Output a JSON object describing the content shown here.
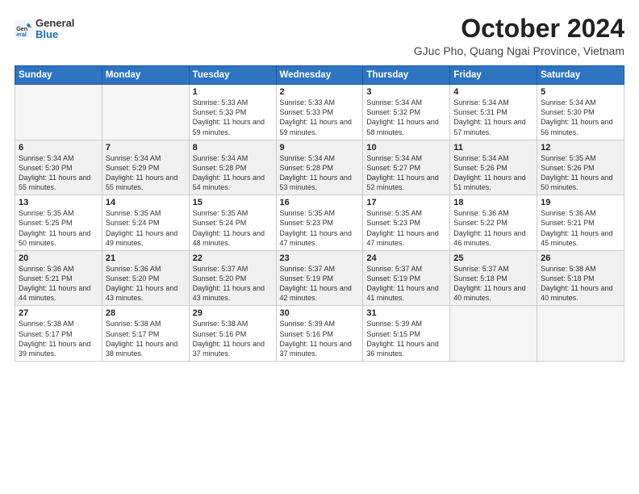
{
  "header": {
    "logo_general": "General",
    "logo_blue": "Blue",
    "month": "October 2024",
    "location": "GJuc Pho, Quang Ngai Province, Vietnam"
  },
  "weekdays": [
    "Sunday",
    "Monday",
    "Tuesday",
    "Wednesday",
    "Thursday",
    "Friday",
    "Saturday"
  ],
  "weeks": [
    [
      {
        "day": "",
        "sunrise": "",
        "sunset": "",
        "daylight": ""
      },
      {
        "day": "",
        "sunrise": "",
        "sunset": "",
        "daylight": ""
      },
      {
        "day": "1",
        "sunrise": "Sunrise: 5:33 AM",
        "sunset": "Sunset: 5:33 PM",
        "daylight": "Daylight: 11 hours and 59 minutes."
      },
      {
        "day": "2",
        "sunrise": "Sunrise: 5:33 AM",
        "sunset": "Sunset: 5:33 PM",
        "daylight": "Daylight: 11 hours and 59 minutes."
      },
      {
        "day": "3",
        "sunrise": "Sunrise: 5:34 AM",
        "sunset": "Sunset: 5:32 PM",
        "daylight": "Daylight: 11 hours and 58 minutes."
      },
      {
        "day": "4",
        "sunrise": "Sunrise: 5:34 AM",
        "sunset": "Sunset: 5:31 PM",
        "daylight": "Daylight: 11 hours and 57 minutes."
      },
      {
        "day": "5",
        "sunrise": "Sunrise: 5:34 AM",
        "sunset": "Sunset: 5:30 PM",
        "daylight": "Daylight: 11 hours and 56 minutes."
      }
    ],
    [
      {
        "day": "6",
        "sunrise": "Sunrise: 5:34 AM",
        "sunset": "Sunset: 5:30 PM",
        "daylight": "Daylight: 11 hours and 55 minutes."
      },
      {
        "day": "7",
        "sunrise": "Sunrise: 5:34 AM",
        "sunset": "Sunset: 5:29 PM",
        "daylight": "Daylight: 11 hours and 55 minutes."
      },
      {
        "day": "8",
        "sunrise": "Sunrise: 5:34 AM",
        "sunset": "Sunset: 5:28 PM",
        "daylight": "Daylight: 11 hours and 54 minutes."
      },
      {
        "day": "9",
        "sunrise": "Sunrise: 5:34 AM",
        "sunset": "Sunset: 5:28 PM",
        "daylight": "Daylight: 11 hours and 53 minutes."
      },
      {
        "day": "10",
        "sunrise": "Sunrise: 5:34 AM",
        "sunset": "Sunset: 5:27 PM",
        "daylight": "Daylight: 11 hours and 52 minutes."
      },
      {
        "day": "11",
        "sunrise": "Sunrise: 5:34 AM",
        "sunset": "Sunset: 5:26 PM",
        "daylight": "Daylight: 11 hours and 51 minutes."
      },
      {
        "day": "12",
        "sunrise": "Sunrise: 5:35 AM",
        "sunset": "Sunset: 5:26 PM",
        "daylight": "Daylight: 11 hours and 50 minutes."
      }
    ],
    [
      {
        "day": "13",
        "sunrise": "Sunrise: 5:35 AM",
        "sunset": "Sunset: 5:25 PM",
        "daylight": "Daylight: 11 hours and 50 minutes."
      },
      {
        "day": "14",
        "sunrise": "Sunrise: 5:35 AM",
        "sunset": "Sunset: 5:24 PM",
        "daylight": "Daylight: 11 hours and 49 minutes."
      },
      {
        "day": "15",
        "sunrise": "Sunrise: 5:35 AM",
        "sunset": "Sunset: 5:24 PM",
        "daylight": "Daylight: 11 hours and 48 minutes."
      },
      {
        "day": "16",
        "sunrise": "Sunrise: 5:35 AM",
        "sunset": "Sunset: 5:23 PM",
        "daylight": "Daylight: 11 hours and 47 minutes."
      },
      {
        "day": "17",
        "sunrise": "Sunrise: 5:35 AM",
        "sunset": "Sunset: 5:23 PM",
        "daylight": "Daylight: 11 hours and 47 minutes."
      },
      {
        "day": "18",
        "sunrise": "Sunrise: 5:36 AM",
        "sunset": "Sunset: 5:22 PM",
        "daylight": "Daylight: 11 hours and 46 minutes."
      },
      {
        "day": "19",
        "sunrise": "Sunrise: 5:36 AM",
        "sunset": "Sunset: 5:21 PM",
        "daylight": "Daylight: 11 hours and 45 minutes."
      }
    ],
    [
      {
        "day": "20",
        "sunrise": "Sunrise: 5:36 AM",
        "sunset": "Sunset: 5:21 PM",
        "daylight": "Daylight: 11 hours and 44 minutes."
      },
      {
        "day": "21",
        "sunrise": "Sunrise: 5:36 AM",
        "sunset": "Sunset: 5:20 PM",
        "daylight": "Daylight: 11 hours and 43 minutes."
      },
      {
        "day": "22",
        "sunrise": "Sunrise: 5:37 AM",
        "sunset": "Sunset: 5:20 PM",
        "daylight": "Daylight: 11 hours and 43 minutes."
      },
      {
        "day": "23",
        "sunrise": "Sunrise: 5:37 AM",
        "sunset": "Sunset: 5:19 PM",
        "daylight": "Daylight: 11 hours and 42 minutes."
      },
      {
        "day": "24",
        "sunrise": "Sunrise: 5:37 AM",
        "sunset": "Sunset: 5:19 PM",
        "daylight": "Daylight: 11 hours and 41 minutes."
      },
      {
        "day": "25",
        "sunrise": "Sunrise: 5:37 AM",
        "sunset": "Sunset: 5:18 PM",
        "daylight": "Daylight: 11 hours and 40 minutes."
      },
      {
        "day": "26",
        "sunrise": "Sunrise: 5:38 AM",
        "sunset": "Sunset: 5:18 PM",
        "daylight": "Daylight: 11 hours and 40 minutes."
      }
    ],
    [
      {
        "day": "27",
        "sunrise": "Sunrise: 5:38 AM",
        "sunset": "Sunset: 5:17 PM",
        "daylight": "Daylight: 11 hours and 39 minutes."
      },
      {
        "day": "28",
        "sunrise": "Sunrise: 5:38 AM",
        "sunset": "Sunset: 5:17 PM",
        "daylight": "Daylight: 11 hours and 38 minutes."
      },
      {
        "day": "29",
        "sunrise": "Sunrise: 5:38 AM",
        "sunset": "Sunset: 5:16 PM",
        "daylight": "Daylight: 11 hours and 37 minutes."
      },
      {
        "day": "30",
        "sunrise": "Sunrise: 5:39 AM",
        "sunset": "Sunset: 5:16 PM",
        "daylight": "Daylight: 11 hours and 37 minutes."
      },
      {
        "day": "31",
        "sunrise": "Sunrise: 5:39 AM",
        "sunset": "Sunset: 5:15 PM",
        "daylight": "Daylight: 11 hours and 36 minutes."
      },
      {
        "day": "",
        "sunrise": "",
        "sunset": "",
        "daylight": ""
      },
      {
        "day": "",
        "sunrise": "",
        "sunset": "",
        "daylight": ""
      }
    ]
  ]
}
